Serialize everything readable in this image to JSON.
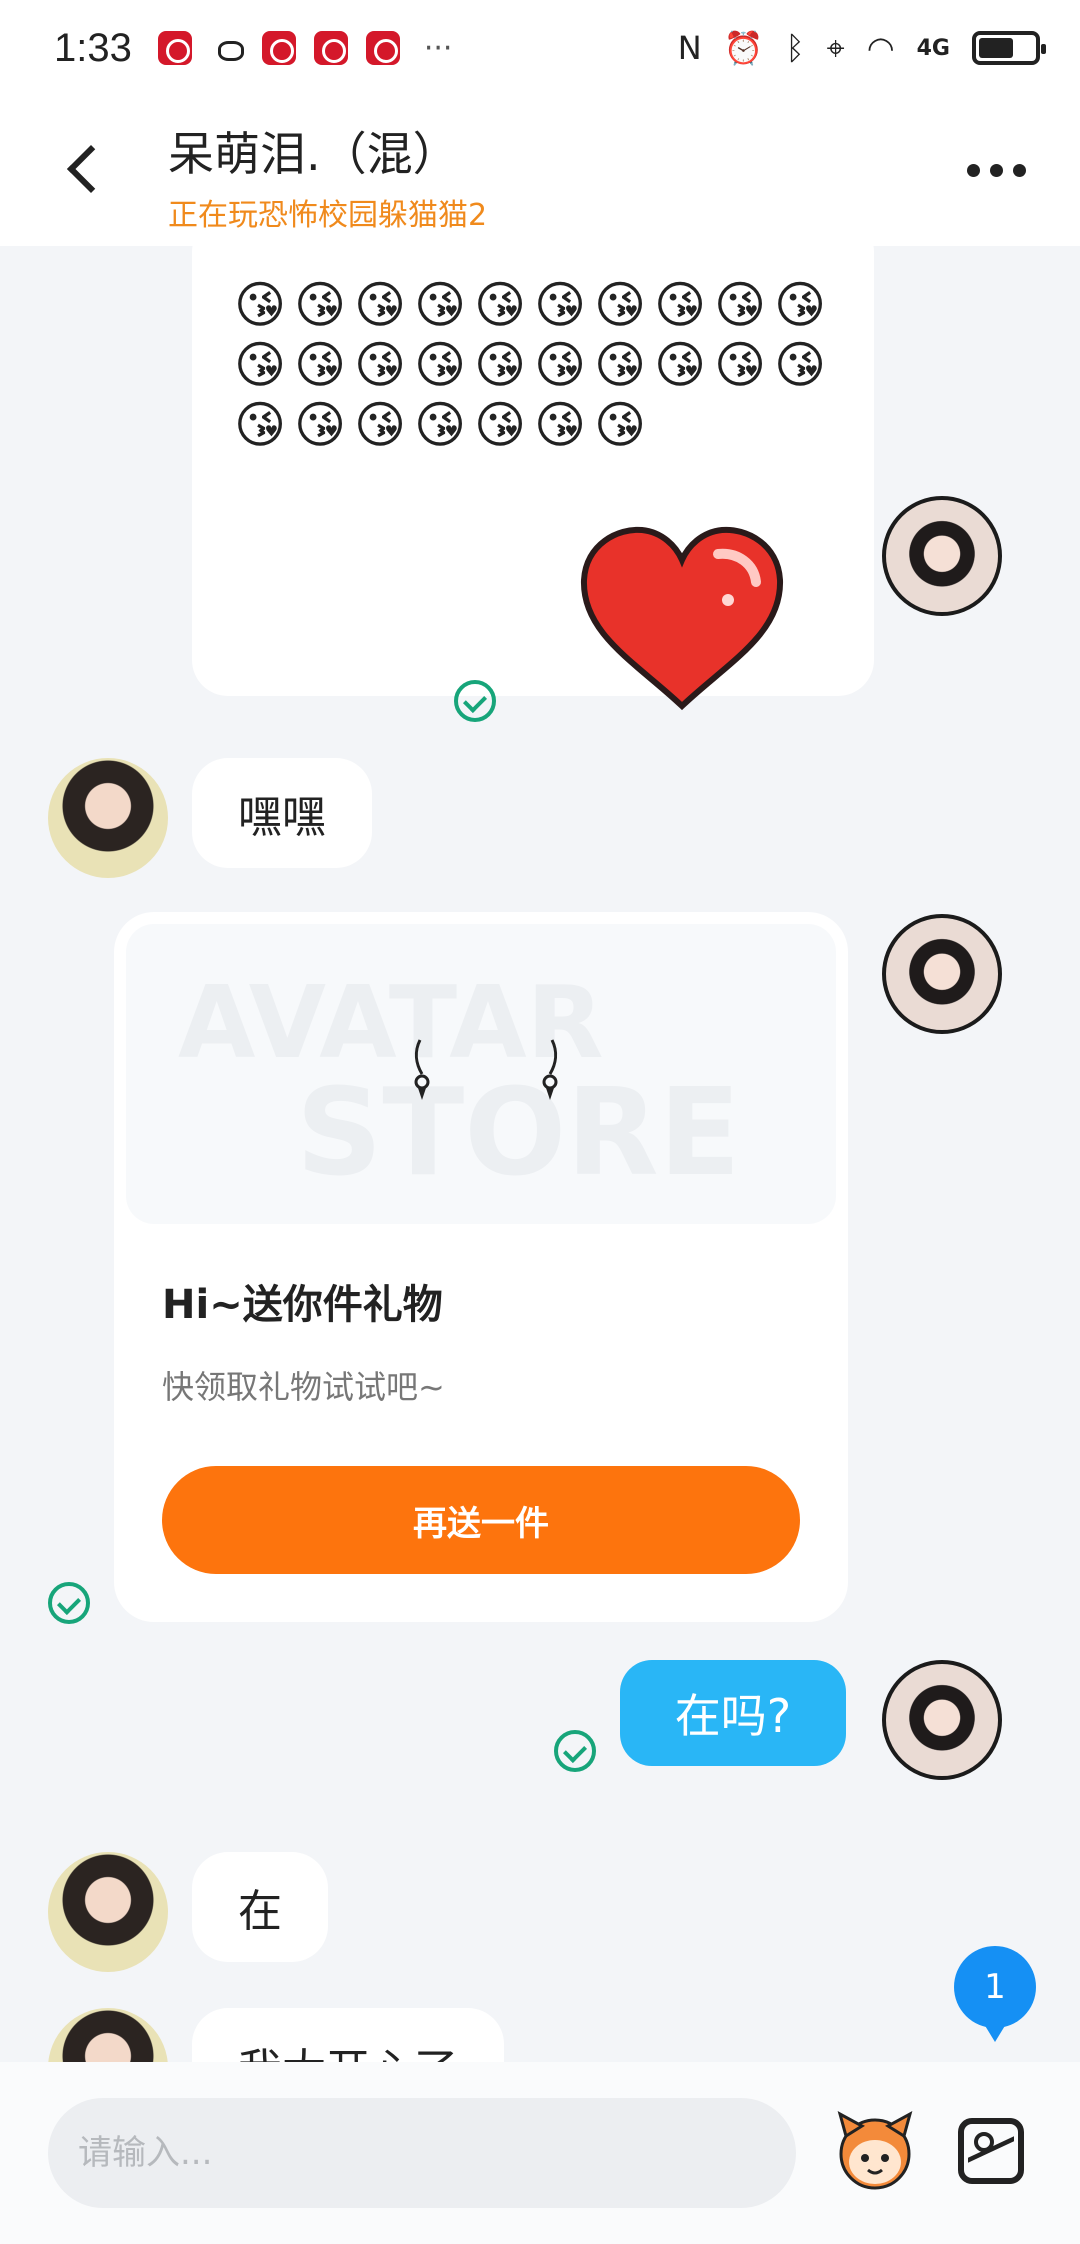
{
  "status_bar": {
    "time": "1:33",
    "more": "···",
    "network": "4G"
  },
  "header": {
    "title": "呆萌泪.（混）",
    "subtitle": "正在玩恐怖校园躲猫猫2"
  },
  "messages": {
    "emoji": "😘",
    "emoji_count": 27,
    "msg_heihei": "嘿嘿",
    "gift": {
      "watermark_1": "AVATAR",
      "watermark_2": "STORE",
      "title": "Hi~送你件礼物",
      "subtitle": "快领取礼物试试吧~",
      "button": "再送一件"
    },
    "msg_zaima": "在吗?",
    "msg_zai": "在",
    "msg_partial": "我太开心了"
  },
  "unread_badge": "1",
  "input": {
    "placeholder": "请输入..."
  },
  "colors": {
    "accent_orange": "#fd740d",
    "subtitle_orange": "#f08a1c",
    "bubble_blue": "#29b6f6",
    "check_green": "#17a57a",
    "badge_blue": "#1590f4"
  }
}
